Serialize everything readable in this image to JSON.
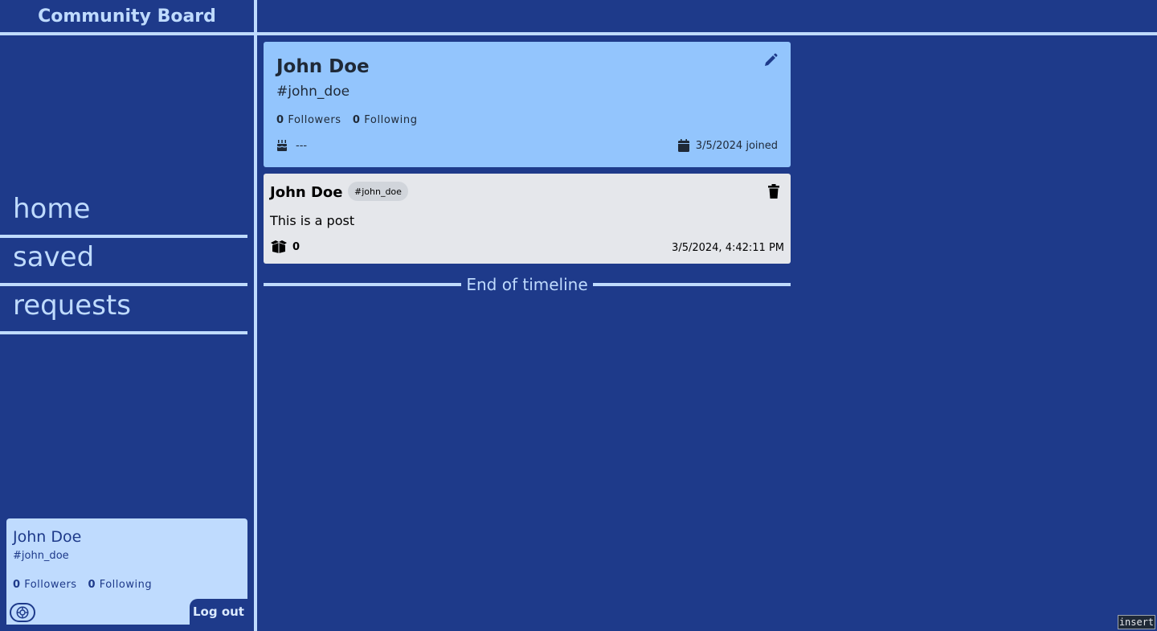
{
  "app": {
    "title": "Community Board"
  },
  "nav": {
    "items": [
      {
        "label": "home"
      },
      {
        "label": "saved"
      },
      {
        "label": "requests"
      }
    ]
  },
  "current_user": {
    "name": "John Doe",
    "handle": "#john_doe",
    "followers_count": "0",
    "followers_label": "Followers",
    "following_count": "0",
    "following_label": "Following",
    "logout_label": "Log out",
    "settings_icon": "settings-gear-icon"
  },
  "profile": {
    "name": "John Doe",
    "handle": "#john_doe",
    "followers_count": "0",
    "followers_label": "Followers",
    "following_count": "0",
    "following_label": "Following",
    "birthday": "---",
    "joined_date": "3/5/2024",
    "joined_label": "joined",
    "edit_icon": "pencil-icon"
  },
  "posts": [
    {
      "author": "John Doe",
      "tag": "#john_doe",
      "content": "This is a post",
      "likes": "0",
      "timestamp": "3/5/2024, 4:42:11 PM"
    }
  ],
  "timeline": {
    "end_label": "End of timeline"
  },
  "badge": {
    "label": "insert"
  },
  "colors": {
    "background": "#1e3a8a",
    "accent_light": "#bfdbfe",
    "profile_card": "#93c5fd",
    "post_card": "#e5e7eb"
  }
}
